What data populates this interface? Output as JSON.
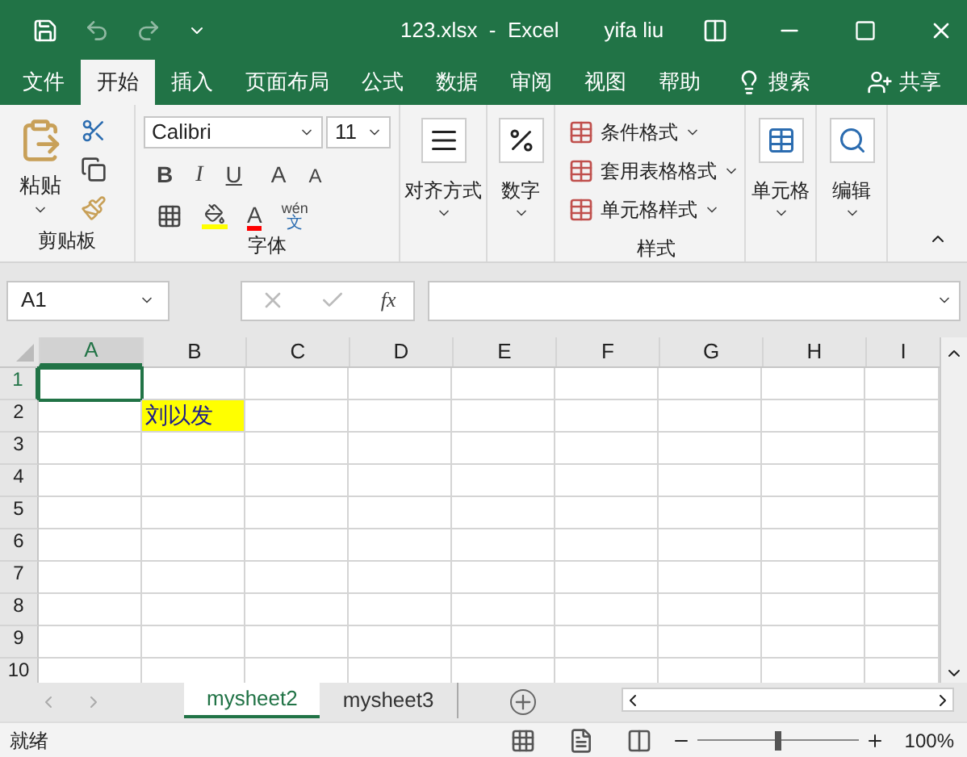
{
  "title_bar": {
    "title": "123.xlsx  -  Excel",
    "user": "yifa liu"
  },
  "menu_tabs": [
    {
      "label": "文件",
      "selected": false
    },
    {
      "label": "开始",
      "selected": true
    },
    {
      "label": "插入",
      "selected": false
    },
    {
      "label": "页面布局",
      "selected": false
    },
    {
      "label": "公式",
      "selected": false
    },
    {
      "label": "数据",
      "selected": false
    },
    {
      "label": "审阅",
      "selected": false
    },
    {
      "label": "视图",
      "selected": false
    },
    {
      "label": "帮助",
      "selected": false
    }
  ],
  "search": "搜索",
  "share": "共享",
  "ribbon": {
    "clipboard": {
      "paste": "粘贴",
      "group": "剪贴板"
    },
    "font": {
      "name": "Calibri",
      "size": "11",
      "bold": "B",
      "italic": "I",
      "underline": "U",
      "grow": "A",
      "shrink": "A",
      "font_color": "A",
      "phonetic_top": "wén",
      "phonetic_bottom": "文",
      "group": "字体"
    },
    "alignment": "对齐方式",
    "number": "数字",
    "styles": {
      "items": [
        "条件格式",
        "套用表格格式",
        "单元格样式"
      ],
      "group": "样式"
    },
    "cells": "单元格",
    "editing": "编辑"
  },
  "formula_bar": {
    "name_box": "A1",
    "fx": "fx"
  },
  "columns": [
    {
      "label": "A",
      "selected": true
    },
    {
      "label": "B",
      "selected": false
    },
    {
      "label": "C",
      "selected": false
    },
    {
      "label": "D",
      "selected": false
    },
    {
      "label": "E",
      "selected": false
    },
    {
      "label": "F",
      "selected": false
    },
    {
      "label": "G",
      "selected": false
    },
    {
      "label": "H",
      "selected": false
    },
    {
      "label": "I",
      "selected": false
    }
  ],
  "rows": [
    {
      "label": "1",
      "selected": true
    },
    {
      "label": "2",
      "selected": false,
      "cells": [
        {},
        {
          "text": "刘以发",
          "highlighted": true
        }
      ]
    },
    {
      "label": "3",
      "selected": false
    },
    {
      "label": "4",
      "selected": false
    },
    {
      "label": "5",
      "selected": false
    },
    {
      "label": "6",
      "selected": false
    },
    {
      "label": "7",
      "selected": false
    },
    {
      "label": "8",
      "selected": false
    },
    {
      "label": "9",
      "selected": false
    },
    {
      "label": "10",
      "selected": false
    }
  ],
  "sheet_tabs": [
    {
      "label": "mysheet2",
      "selected": true
    },
    {
      "label": "mysheet3",
      "selected": false
    }
  ],
  "status": "就绪",
  "zoom": {
    "level": 0.5,
    "reading": "100%"
  }
}
